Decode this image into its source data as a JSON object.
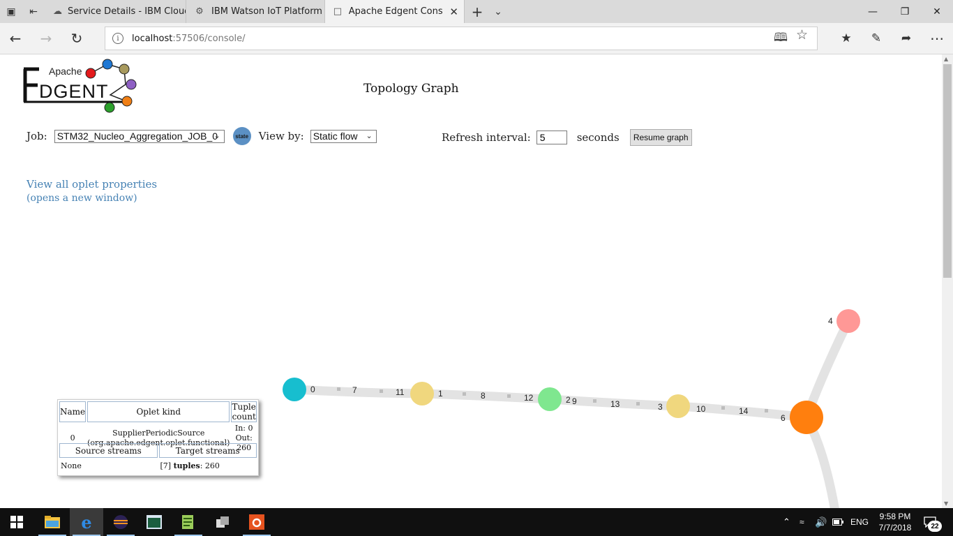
{
  "browser": {
    "tabs": [
      {
        "title": "Service Details - IBM Cloud",
        "icon": "cloud-icon"
      },
      {
        "title": "IBM Watson IoT Platform",
        "icon": "watson-iot-icon"
      },
      {
        "title": "Apache Edgent Console",
        "icon": "page-icon"
      }
    ],
    "url_host": "localhost",
    "url_rest": ":57506/console/"
  },
  "logo": {
    "top_text": "Apache",
    "main_text": "EDGENT"
  },
  "header": {
    "title": "Topology Graph"
  },
  "controls": {
    "job_label": "Job:",
    "job_value": "STM32_Nucleo_Aggregation_JOB_0",
    "state_button": "state",
    "view_by_label": "View by:",
    "view_by_value": "Static flow",
    "refresh_label": "Refresh interval:",
    "refresh_value": "5",
    "seconds_label": "seconds",
    "resume_button": "Resume graph"
  },
  "links": {
    "oplet_properties": "View all oplet properties",
    "oplet_properties_note": "(opens a new window)"
  },
  "graph": {
    "node_labels": [
      "0",
      "1",
      "2",
      "3",
      "4",
      "6"
    ],
    "edge_labels": [
      "7",
      "11",
      "8",
      "12",
      "9",
      "13",
      "10",
      "14"
    ],
    "node_colors": {
      "0": "#17becf",
      "1": "#f0d77e",
      "2": "#7fe78f",
      "3": "#f0d77e",
      "4": "#ff9896",
      "6": "#ff7f0e"
    }
  },
  "tooltip": {
    "headers": [
      "Name",
      "Oplet kind",
      "Tuple count"
    ],
    "name": "0",
    "kind_line1": "SupplierPeriodicSource",
    "kind_line2": "(org.apache.edgent.oplet.functional)",
    "count_in": "In: 0",
    "count_out": "Out: 260",
    "stream_headers": [
      "Source streams",
      "Target streams"
    ],
    "source_streams": "None",
    "target_stream_id": "[7]",
    "target_tuples_label": "tuples",
    "target_tuples_value": ": 260"
  },
  "taskbar": {
    "language": "ENG",
    "time": "9:58 PM",
    "date": "7/7/2018",
    "notifications": "22"
  }
}
